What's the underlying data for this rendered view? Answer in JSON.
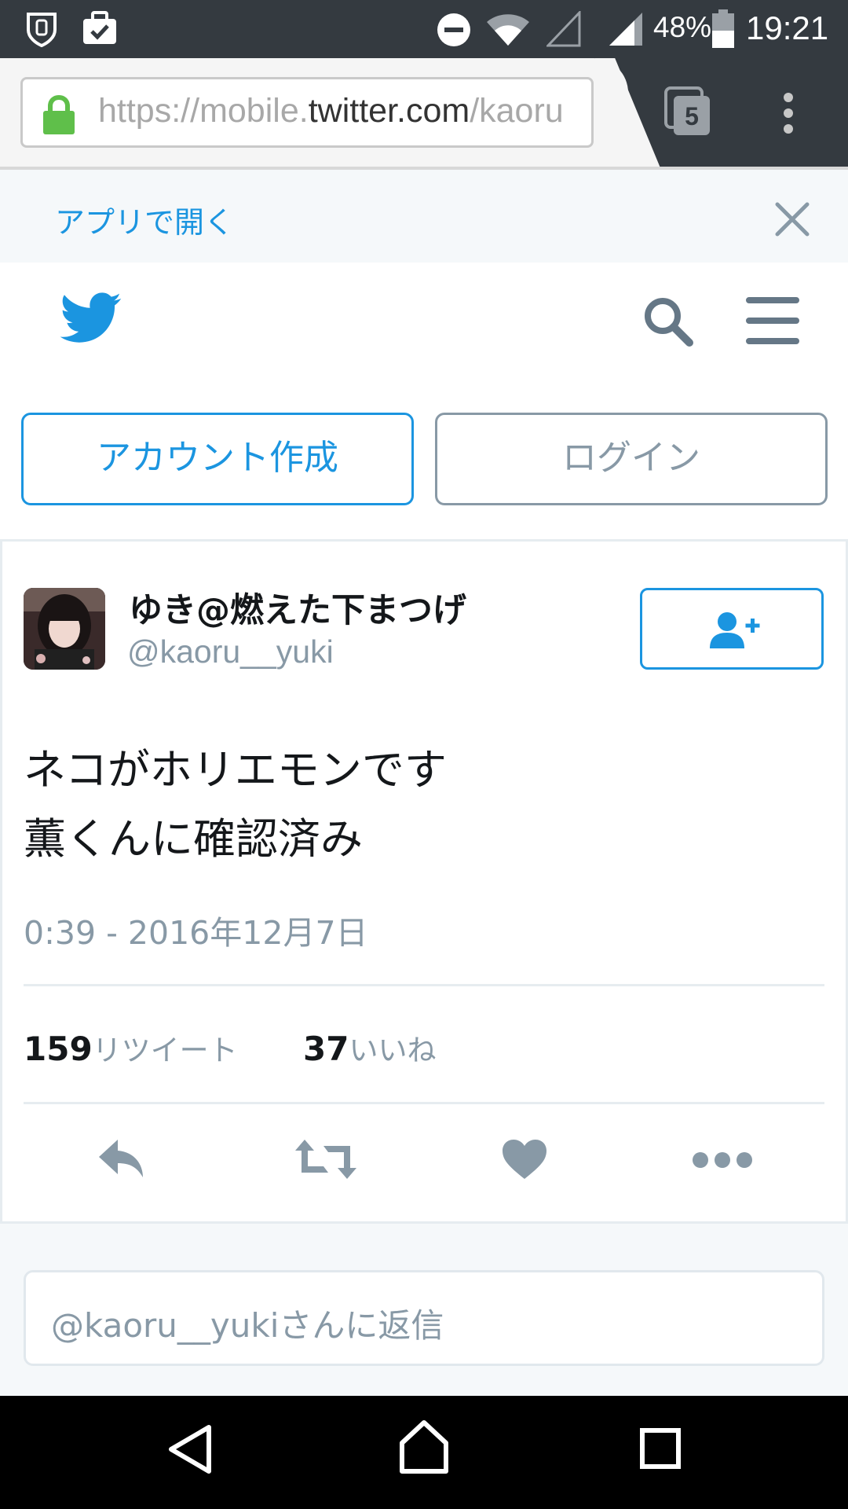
{
  "status_bar": {
    "battery": "48%",
    "time": "19:21",
    "icons": [
      "shield-icon",
      "work-bag-icon",
      "do-not-disturb-icon",
      "wifi-icon",
      "no-sim-icon",
      "cell-signal-icon",
      "battery-icon"
    ]
  },
  "browser": {
    "url_prefix": "https://mobile.",
    "url_domain": "twitter.com",
    "url_suffix": "/kaoru",
    "tab_count": "5"
  },
  "app_banner": {
    "label": "アプリで開く"
  },
  "auth": {
    "signup_label": "アカウント作成",
    "login_label": "ログイン"
  },
  "tweet": {
    "display_name": "ゆき@燃えた下まつげ",
    "handle": "@kaoru__yuki",
    "text_line1": "ネコがホリエモンです",
    "text_line2": "薫くんに確認済み",
    "timestamp": "0:39 - 2016年12月7日",
    "retweet_count": "159",
    "retweet_label": "リツイート",
    "like_count": "37",
    "like_label": "いいね"
  },
  "reply": {
    "placeholder": "@kaoru__yukiさんに返信"
  },
  "colors": {
    "twitter_blue": "#1b95e0",
    "gray_text": "#8899a6",
    "dark_text": "#14171a",
    "status_bar": "#343a40"
  }
}
